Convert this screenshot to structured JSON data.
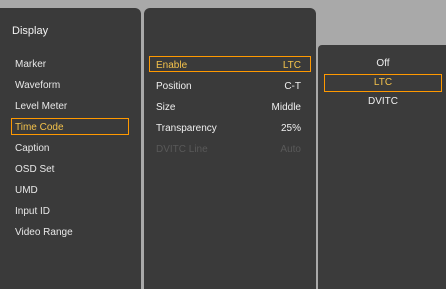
{
  "menu": {
    "title": "Display",
    "items": [
      {
        "label": "Marker",
        "selected": false
      },
      {
        "label": "Waveform",
        "selected": false
      },
      {
        "label": "Level Meter",
        "selected": false
      },
      {
        "label": "Time Code",
        "selected": true
      },
      {
        "label": "Caption",
        "selected": false
      },
      {
        "label": "OSD Set",
        "selected": false
      },
      {
        "label": "UMD",
        "selected": false
      },
      {
        "label": "Input ID",
        "selected": false
      },
      {
        "label": "Video Range",
        "selected": false
      }
    ]
  },
  "settings": {
    "rows": [
      {
        "label": "Enable",
        "value": "LTC",
        "state": "active"
      },
      {
        "label": "Position",
        "value": "C-T",
        "state": "normal"
      },
      {
        "label": "Size",
        "value": "Middle",
        "state": "normal"
      },
      {
        "label": "Transparency",
        "value": "25%",
        "state": "normal"
      },
      {
        "label": "DVITC Line",
        "value": "Auto",
        "state": "disabled"
      }
    ]
  },
  "options": {
    "items": [
      {
        "label": "Off",
        "selected": false
      },
      {
        "label": "LTC",
        "selected": true
      },
      {
        "label": "DVITC",
        "selected": false
      }
    ]
  },
  "colors": {
    "background": "#a9a9a9",
    "panel": "#3a3a3a",
    "text": "#efefef",
    "accent": "#ff9900",
    "selected_text": "#f4c24b",
    "disabled_text": "#595959"
  }
}
